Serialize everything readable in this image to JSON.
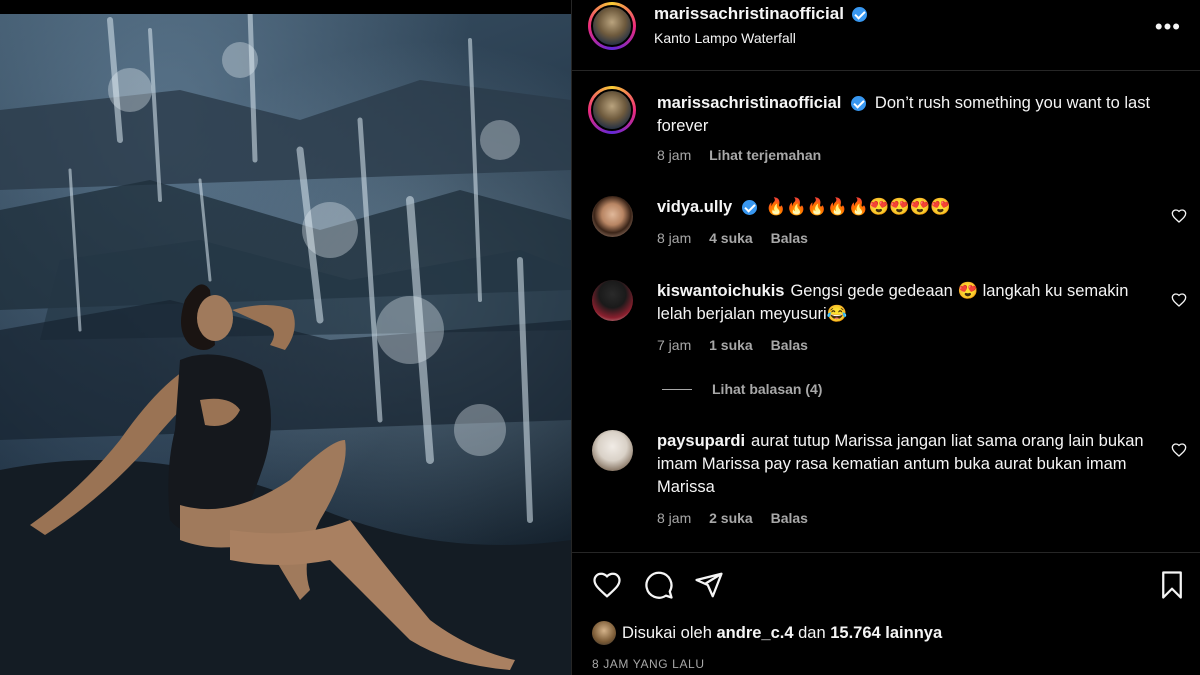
{
  "post": {
    "username": "marissachristinaofficial",
    "location": "Kanto Lampo Waterfall",
    "more_icon": "more-horizontal-icon"
  },
  "caption": {
    "username": "marissachristinaofficial",
    "text": "Don’t rush something you want to last forever",
    "time": "8 jam",
    "translate": "Lihat terjemahan"
  },
  "comments": [
    {
      "username": "vidya.ully",
      "verified": true,
      "text": "🔥🔥🔥🔥🔥😍😍😍😍",
      "time": "8 jam",
      "likes": "4 suka",
      "reply": "Balas"
    },
    {
      "username": "kiswantoichukis",
      "verified": false,
      "text": "Gengsi gede gedeaan 😍 langkah ku semakin lelah berjalan meyusuri😂",
      "time": "7 jam",
      "likes": "1 suka",
      "reply": "Balas",
      "view_replies": "Lihat balasan (4)"
    },
    {
      "username": "paysupardi",
      "verified": false,
      "text": "aurat tutup Marissa jangan liat sama orang lain bukan imam Marissa pay rasa kematian antum buka aurat bukan imam Marissa",
      "time": "8 jam",
      "likes": "2 suka",
      "reply": "Balas"
    }
  ],
  "actions": {
    "like_icon": "heart-icon",
    "comment_icon": "comment-icon",
    "share_icon": "send-icon",
    "save_icon": "bookmark-icon"
  },
  "likes": {
    "prefix": "Disukai oleh",
    "user": "andre_c.4",
    "connector": "dan",
    "count": "15.764 lainnya"
  },
  "time_ago": "8 JAM YANG LALU",
  "colors": {
    "background": "#000000",
    "text": "#f5f5f5",
    "secondary": "#a8a8a8",
    "verified": "#3897f0",
    "divider": "#262626"
  }
}
